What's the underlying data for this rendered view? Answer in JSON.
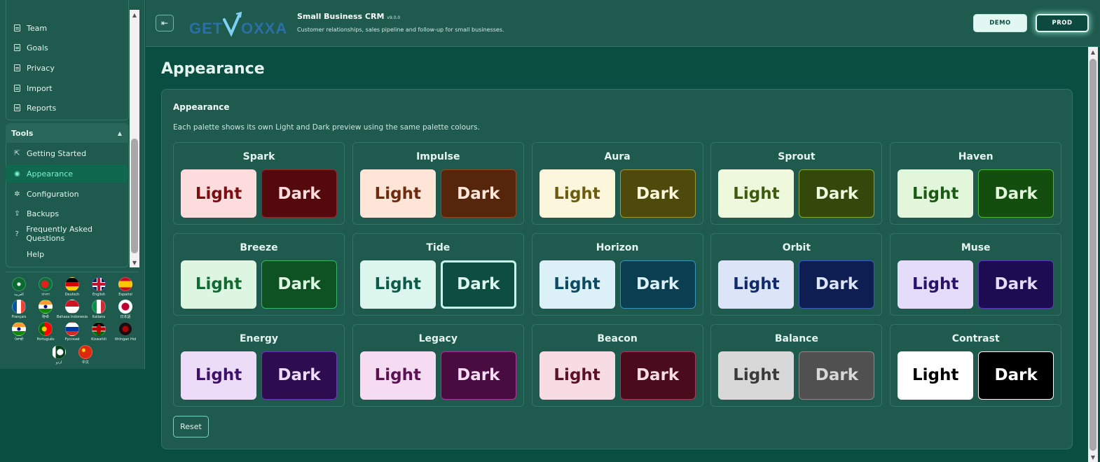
{
  "sidebar": {
    "nav_items": [
      {
        "label": "Team",
        "icon": "document-icon"
      },
      {
        "label": "Goals",
        "icon": "document-icon"
      },
      {
        "label": "Privacy",
        "icon": "document-icon"
      },
      {
        "label": "Import",
        "icon": "document-icon"
      },
      {
        "label": "Reports",
        "icon": "document-icon"
      }
    ],
    "tools": {
      "label": "Tools",
      "items": [
        {
          "label": "Getting Started",
          "icon": "start-icon",
          "glyph": "⇱"
        },
        {
          "label": "Appearance",
          "icon": "palette-icon",
          "glyph": "◉",
          "active": true
        },
        {
          "label": "Configuration",
          "icon": "gear-icon",
          "glyph": "✲"
        },
        {
          "label": "Backups",
          "icon": "upload-icon",
          "glyph": "⇪"
        },
        {
          "label": "Frequently Asked Questions",
          "icon": "help-circle-icon",
          "glyph": "?"
        },
        {
          "label": "Help",
          "icon": "",
          "glyph": ""
        }
      ]
    },
    "languages": [
      {
        "label": "العربية",
        "flag": "saudi-arabia"
      },
      {
        "label": "বাংলা",
        "flag": "bangladesh"
      },
      {
        "label": "Deutsch",
        "flag": "germany"
      },
      {
        "label": "English",
        "flag": "uk"
      },
      {
        "label": "Español",
        "flag": "spain"
      },
      {
        "label": "Français",
        "flag": "france"
      },
      {
        "label": "हिन्दी",
        "flag": "india"
      },
      {
        "label": "Bahasa Indonesia",
        "flag": "indonesia"
      },
      {
        "label": "Italiano",
        "flag": "italy"
      },
      {
        "label": "日本語",
        "flag": "japan"
      },
      {
        "label": "ਪੰਜਾਬੀ",
        "flag": "india"
      },
      {
        "label": "Português",
        "flag": "portugal"
      },
      {
        "label": "Русский",
        "flag": "russia"
      },
      {
        "label": "Kiswahili",
        "flag": "kenya"
      },
      {
        "label": "tlhIngan Hol",
        "flag": "klingon"
      },
      {
        "label": "اردو",
        "flag": "pakistan"
      },
      {
        "label": "中文",
        "flag": "china"
      }
    ]
  },
  "header": {
    "logo_text": "GETVOXXA",
    "app_title": "Small Business CRM",
    "app_version": "v9.0.0",
    "app_subtitle": "Customer relationships, sales pipeline and follow-up for small businesses.",
    "demo_label": "DEMO",
    "prod_label": "PROD"
  },
  "main": {
    "page_title": "Appearance",
    "card_title": "Appearance",
    "card_description": "Each palette shows its own Light and Dark preview using the same palette colours.",
    "light_label": "Light",
    "dark_label": "Dark",
    "reset_label": "Reset",
    "palettes": [
      {
        "name": "Spark",
        "light_bg": "#fcdcdc",
        "light_fg": "#7a0e12",
        "dark_bg": "#540a0c",
        "dark_fg": "#fcdcdc",
        "dark_border": "#8c2a2c"
      },
      {
        "name": "Impulse",
        "light_bg": "#fde6d8",
        "light_fg": "#6e2b10",
        "dark_bg": "#56260c",
        "dark_fg": "#fde6d8",
        "dark_border": "#8c4a26"
      },
      {
        "name": "Aura",
        "light_bg": "#fcf6dc",
        "light_fg": "#6a5c10",
        "dark_bg": "#4e4a0c",
        "dark_fg": "#fcf6dc",
        "dark_border": "#a09a3a"
      },
      {
        "name": "Sprout",
        "light_bg": "#eef8dc",
        "light_fg": "#3e5a0e",
        "dark_bg": "#34480c",
        "dark_fg": "#eef8dc",
        "dark_border": "#8aa83a"
      },
      {
        "name": "Haven",
        "light_bg": "#e2f6dc",
        "light_fg": "#1a5a12",
        "dark_bg": "#144e0e",
        "dark_fg": "#e2f6dc",
        "dark_border": "#52b43a"
      },
      {
        "name": "Breeze",
        "light_bg": "#dcf6e2",
        "light_fg": "#126a32",
        "dark_bg": "#0e5224",
        "dark_fg": "#dcf6e2",
        "dark_border": "#3ab464"
      },
      {
        "name": "Tide",
        "light_bg": "#dcf6ee",
        "light_fg": "#0e5a4a",
        "dark_bg": "#0e4e42",
        "dark_fg": "#dcf6ee",
        "dark_border": "#c8f8ec",
        "selected": true
      },
      {
        "name": "Horizon",
        "light_bg": "#dcf0f8",
        "light_fg": "#0e4a62",
        "dark_bg": "#0c3e52",
        "dark_fg": "#dcf0f8",
        "dark_border": "#3a94b4"
      },
      {
        "name": "Orbit",
        "light_bg": "#dce4f8",
        "light_fg": "#122a6a",
        "dark_bg": "#0e1e52",
        "dark_fg": "#dce4f8",
        "dark_border": "#3a5ab4"
      },
      {
        "name": "Muse",
        "light_bg": "#e4dcf8",
        "light_fg": "#2a126a",
        "dark_bg": "#1e0c52",
        "dark_fg": "#e4dcf8",
        "dark_border": "#5a3ab4"
      },
      {
        "name": "Energy",
        "light_bg": "#ecdcf8",
        "light_fg": "#3e126a",
        "dark_bg": "#2e0c50",
        "dark_fg": "#ecdcf8",
        "dark_border": "#6a3ab4"
      },
      {
        "name": "Legacy",
        "light_bg": "#f6dcf2",
        "light_fg": "#5a1250",
        "dark_bg": "#480c40",
        "dark_fg": "#f6dcf2",
        "dark_border": "#a43a94"
      },
      {
        "name": "Beacon",
        "light_bg": "#f8dce4",
        "light_fg": "#5a1224",
        "dark_bg": "#4a0c1c",
        "dark_fg": "#f8dce4",
        "dark_border": "#a43a56"
      },
      {
        "name": "Balance",
        "light_bg": "#d8d8d8",
        "light_fg": "#3a3a3a",
        "dark_bg": "#505050",
        "dark_fg": "#d8d8d8",
        "dark_border": "#8a8a8a"
      },
      {
        "name": "Contrast",
        "light_bg": "#ffffff",
        "light_fg": "#000000",
        "dark_bg": "#000000",
        "dark_fg": "#ffffff",
        "dark_border": "#ffffff"
      }
    ]
  }
}
